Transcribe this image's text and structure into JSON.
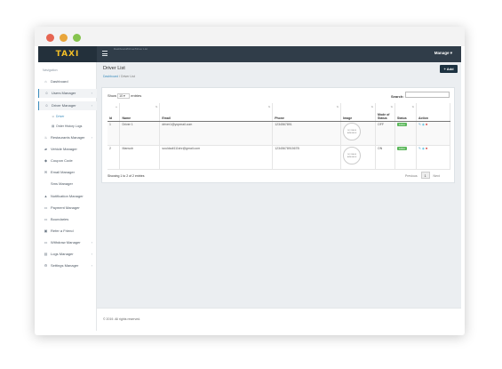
{
  "brand": {
    "logo": "TAXI",
    "faint_text": "Dashboard/Driver/Driver List"
  },
  "topbar": {
    "manage_label": "Manage ▾"
  },
  "sidebar": {
    "heading": "Navigation",
    "items": [
      {
        "label": "Dashboard",
        "icon": "home-icon",
        "glyph": "⌂"
      },
      {
        "label": "Users Manager",
        "icon": "user-icon",
        "glyph": "☺",
        "chevron": "›"
      },
      {
        "label": "Driver Manager",
        "icon": "user-icon",
        "glyph": "☺",
        "chevron": "›"
      },
      {
        "label": "Restaurants Manager",
        "icon": "utensils-icon",
        "glyph": "♨",
        "chevron": "›"
      },
      {
        "label": "Vehicle Manager",
        "icon": "car-icon",
        "glyph": "▰"
      },
      {
        "label": "Coupon Code",
        "icon": "tag-icon",
        "glyph": "◆"
      },
      {
        "label": "Email Manager",
        "icon": "envelope-icon",
        "glyph": "✉"
      },
      {
        "label": "Sms Manager",
        "icon": "",
        "glyph": ""
      },
      {
        "label": "Notification Manager",
        "icon": "bell-icon",
        "glyph": "▲"
      },
      {
        "label": "Payment Manager",
        "icon": "payment-icon",
        "glyph": "▭"
      },
      {
        "label": "Boundaries",
        "icon": "map-icon",
        "glyph": "▭"
      },
      {
        "label": "Refer a Friend",
        "icon": "gift-icon",
        "glyph": "▣"
      },
      {
        "label": "Withdraw Manager",
        "icon": "withdraw-icon",
        "glyph": "▭",
        "chevron": "›"
      },
      {
        "label": "Logs Manager",
        "icon": "log-icon",
        "glyph": "▤",
        "chevron": "›"
      },
      {
        "label": "Settings Manager",
        "icon": "gear-icon",
        "glyph": "⚙",
        "chevron": "›"
      }
    ],
    "subitems": [
      {
        "label": "Driver",
        "glyph": "☺"
      },
      {
        "label": "Order History Logs",
        "glyph": "▤"
      }
    ]
  },
  "page": {
    "title": "Driver List",
    "breadcrumb": {
      "home": "Dashboard",
      "sep": "/",
      "current": "Driver List"
    },
    "add_button": "+ Add"
  },
  "table": {
    "show_label": "Show",
    "show_value": "10 ▾",
    "entries_label": "entries",
    "search_label": "Search:",
    "columns": [
      "Id",
      "Name",
      "Email",
      "Phone",
      "Image",
      "Mode of Status",
      "Status",
      "Action"
    ],
    "rows": [
      {
        "id": "1",
        "name": "Driver 1",
        "email": "driver1@yopmail.com",
        "phone": "1234567891",
        "image": "NO IMAGE AVAILABLE",
        "mode": "OFF",
        "status": "Active"
      },
      {
        "id": "2",
        "name": "Mansob",
        "email": "souldadi111shr@gmail.com",
        "phone": "1234567891567B",
        "image": "NO IMAGE AVAILABLE",
        "mode": "ON",
        "status": "Active"
      }
    ],
    "info": "Showing 1 to 2 of 2 entries",
    "pager": {
      "prev": "Previous",
      "page": "1",
      "next": "Next"
    }
  },
  "footer": {
    "text": "© 2019. All rights reserved."
  },
  "colors": {
    "topbar": "#303d49",
    "logo_bg": "#23303b",
    "logo_text": "#f3bf27",
    "active_badge": "#5cb85c",
    "add_button": "#1d3241",
    "link": "#3c8dbc"
  }
}
